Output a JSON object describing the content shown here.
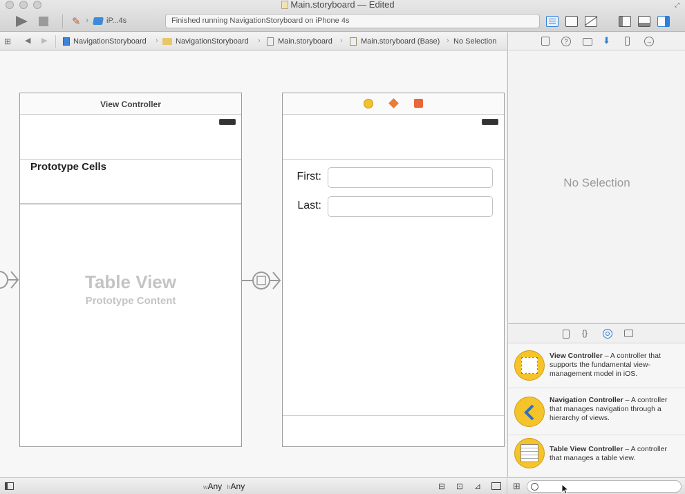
{
  "window": {
    "title": "Main.storyboard — Edited",
    "scheme_device": "iP...4s",
    "activity_status": "Finished running NavigationStoryboard on iPhone 4s"
  },
  "jumpbar": {
    "items": [
      "NavigationStoryboard",
      "NavigationStoryboard",
      "Main.storyboard",
      "Main.storyboard (Base)",
      "No Selection"
    ]
  },
  "canvas": {
    "scene1": {
      "title": "View Controller",
      "section_label": "Prototype Cells",
      "placeholder_title": "Table View",
      "placeholder_subtitle": "Prototype Content"
    },
    "scene2": {
      "fields": [
        {
          "label": "First:",
          "value": ""
        },
        {
          "label": "Last:",
          "value": ""
        }
      ]
    }
  },
  "inspector": {
    "empty_message": "No Selection"
  },
  "library": {
    "items": [
      {
        "name": "View Controller",
        "description": " – A controller that supports the fundamental view-management model in iOS.",
        "icon": "view-controller-icon"
      },
      {
        "name": "Navigation Controller",
        "description": " – A controller that manages navigation through a hierarchy of views.",
        "icon": "navigation-controller-icon"
      },
      {
        "name": "Table View Controller",
        "description": " – A controller that manages a table view.",
        "icon": "table-view-controller-icon"
      }
    ],
    "filter_placeholder": ""
  },
  "bottombar": {
    "size_class_w_prefix": "w",
    "size_class_w": "Any",
    "size_class_h_prefix": "h",
    "size_class_h": "Any"
  },
  "colors": {
    "accent_blue": "#2f7fd6",
    "library_icon_yellow": "#f5c32a",
    "scene_border": "#9b9b9b"
  }
}
